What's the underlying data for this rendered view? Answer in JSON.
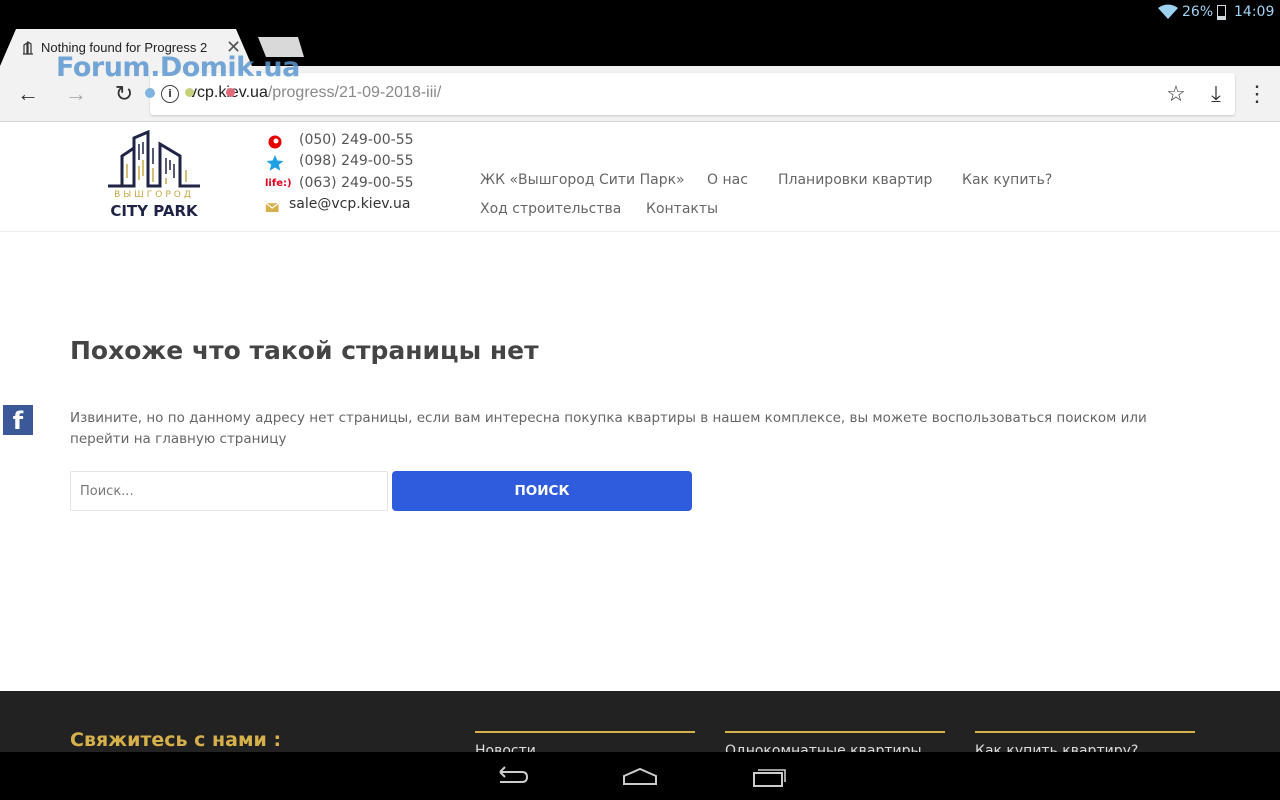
{
  "status_bar": {
    "battery_percent": "26%",
    "time": "14:09"
  },
  "tab": {
    "title": "Nothing found for Progress 2",
    "close_symbol": "✕"
  },
  "toolbar": {
    "back_symbol": "←",
    "forward_symbol": "→",
    "reload_symbol": "↻",
    "url_host": "vcp.kiev.ua",
    "url_path": "/progress/21-09-2018-iii/",
    "info_symbol": "i",
    "bookmark_symbol": "☆",
    "download_symbol": "⤓",
    "menu_symbol": "⋮"
  },
  "watermark": "Forum.Domik.ua",
  "logo": {
    "line1": "ВЫШГОРОД",
    "line2": "CITY PARK"
  },
  "contacts": {
    "phone1": "(050) 249-00-55",
    "phone2": "(098) 249-00-55",
    "phone3": "(063) 249-00-55",
    "email": "sale@vcp.kiev.ua",
    "life_label": "life:)"
  },
  "nav": {
    "item1": "ЖК «Вышгород Сити Парк»",
    "item2": "О нас",
    "item3": "Планировки квартир",
    "item4": "Как купить?",
    "item5": "Ход строительства",
    "item6": "Контакты"
  },
  "facebook_letter": "f",
  "content": {
    "heading": "Похоже что такой страницы нет",
    "message": "Извините, но по данному адресу нет страницы, если вам интересна покупка квартиры в нашем комплексе, вы можете воспользоваться поиском или перейти на главную страницу",
    "search_placeholder": "Поиск...",
    "search_button": "ПОИСК"
  },
  "footer": {
    "heading": "Свяжитесь с нами :",
    "col1": "Новости",
    "col2": "Однокомнатные квартиры",
    "col3": "Как купить квартиру?"
  },
  "colors": {
    "accent_gold": "#d6b14b",
    "button_blue": "#2f5bdd",
    "navy": "#1f2346",
    "facebook": "#3b5998"
  }
}
